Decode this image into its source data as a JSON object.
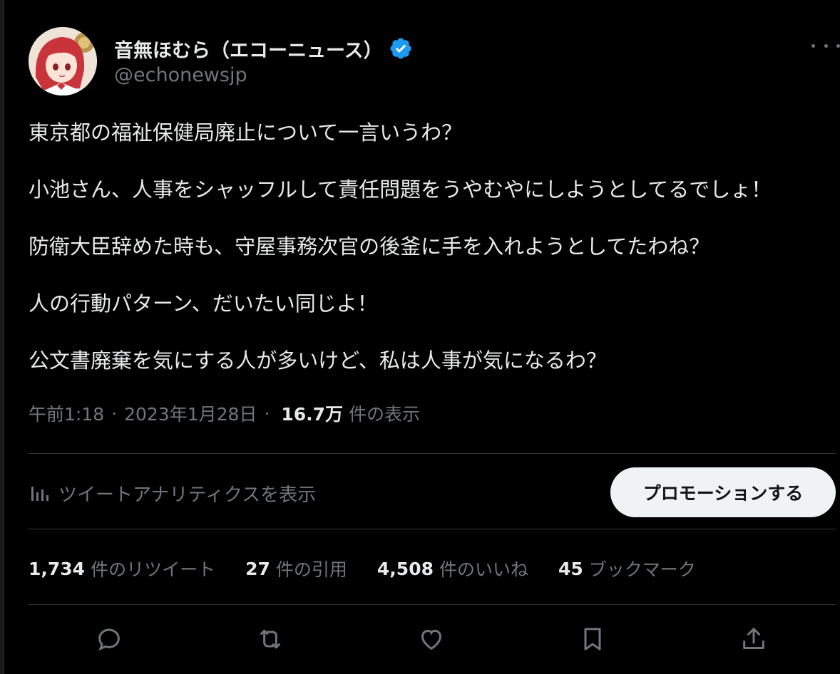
{
  "author": {
    "display_name": "音無ほむら（エコーニュース）",
    "handle": "@echonewsjp",
    "verified_icon": "verified-badge-icon",
    "verified_color": "#1d9bf0"
  },
  "tweet": {
    "paragraphs": [
      "東京都の福祉保健局廃止について一言いうわ？",
      "小池さん、人事をシャッフルして責任問題をうやむやにしようとしてるでしょ！",
      "防衛大臣辞めた時も、守屋事務次官の後釜に手を入れようとしてたわね？",
      "人の行動パターン、だいたい同じよ！",
      "公文書廃棄を気にする人が多いけど、私は人事が気になるわ？"
    ],
    "time": "午前1:18",
    "date": "2023年1月28日",
    "separator": "·",
    "views_count": "16.7万",
    "views_label": "件の表示"
  },
  "analytics": {
    "label": "ツイートアナリティクスを表示",
    "icon": "analytics-bar-icon"
  },
  "promote_button": "プロモーションする",
  "stats": {
    "retweets": {
      "count": "1,734",
      "label": "件のリツイート"
    },
    "quotes": {
      "count": "27",
      "label": "件の引用"
    },
    "likes": {
      "count": "4,508",
      "label": "件のいいね"
    },
    "bookmarks": {
      "count": "45",
      "label": "ブックマーク"
    }
  },
  "actions": [
    "reply-icon",
    "retweet-icon",
    "like-icon",
    "bookmark-icon",
    "share-icon"
  ],
  "colors": {
    "background": "#000000",
    "text_primary": "#e7e9ea",
    "text_secondary": "#71767b",
    "divider": "#2f3336",
    "button_bg": "#eff3f4"
  }
}
